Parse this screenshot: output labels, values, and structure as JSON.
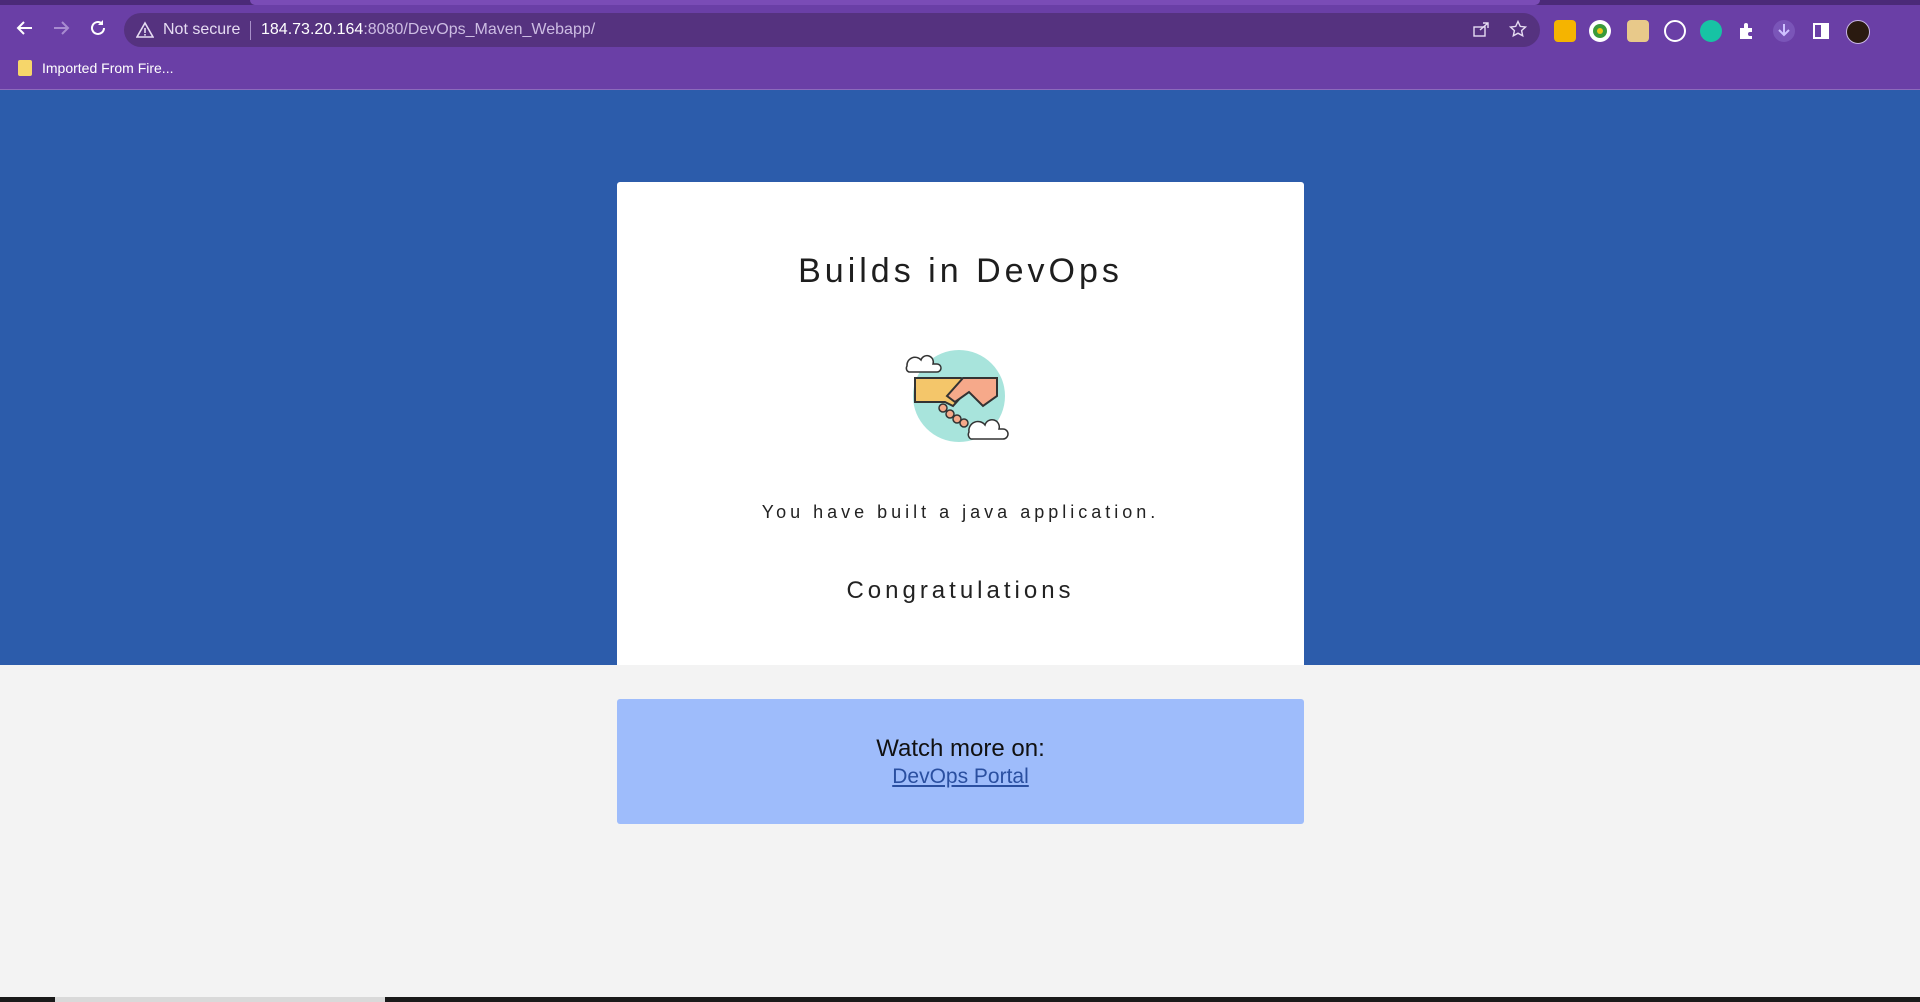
{
  "browser": {
    "security_label": "Not secure",
    "url_host": "184.73.20.164",
    "url_path": ":8080/DevOps_Maven_Webapp/",
    "bookmarks": [
      {
        "label": "Imported From Fire..."
      }
    ],
    "icons": {
      "back": "back-arrow-icon",
      "forward": "forward-arrow-icon",
      "reload": "reload-icon",
      "warning": "warning-triangle-icon",
      "share": "share-icon",
      "star": "star-icon",
      "extensions": "puzzle-icon",
      "download": "download-icon",
      "side_panel": "side-panel-icon",
      "profile": "avatar"
    },
    "colors": {
      "toolbar": "#6a3fa6",
      "omnibox": "#55327f"
    }
  },
  "page": {
    "card": {
      "title": "Builds in DevOps",
      "message": "You have built a java application.",
      "congrats": "Congratulations",
      "illustration": "handshake-icon"
    },
    "promo": {
      "label": "Watch more on:",
      "link_text": "DevOps Portal"
    },
    "colors": {
      "hero_background": "#2c5cab",
      "page_background": "#f3f3f3",
      "promo_background": "#9ebcfb",
      "link": "#2a4fa0"
    }
  }
}
